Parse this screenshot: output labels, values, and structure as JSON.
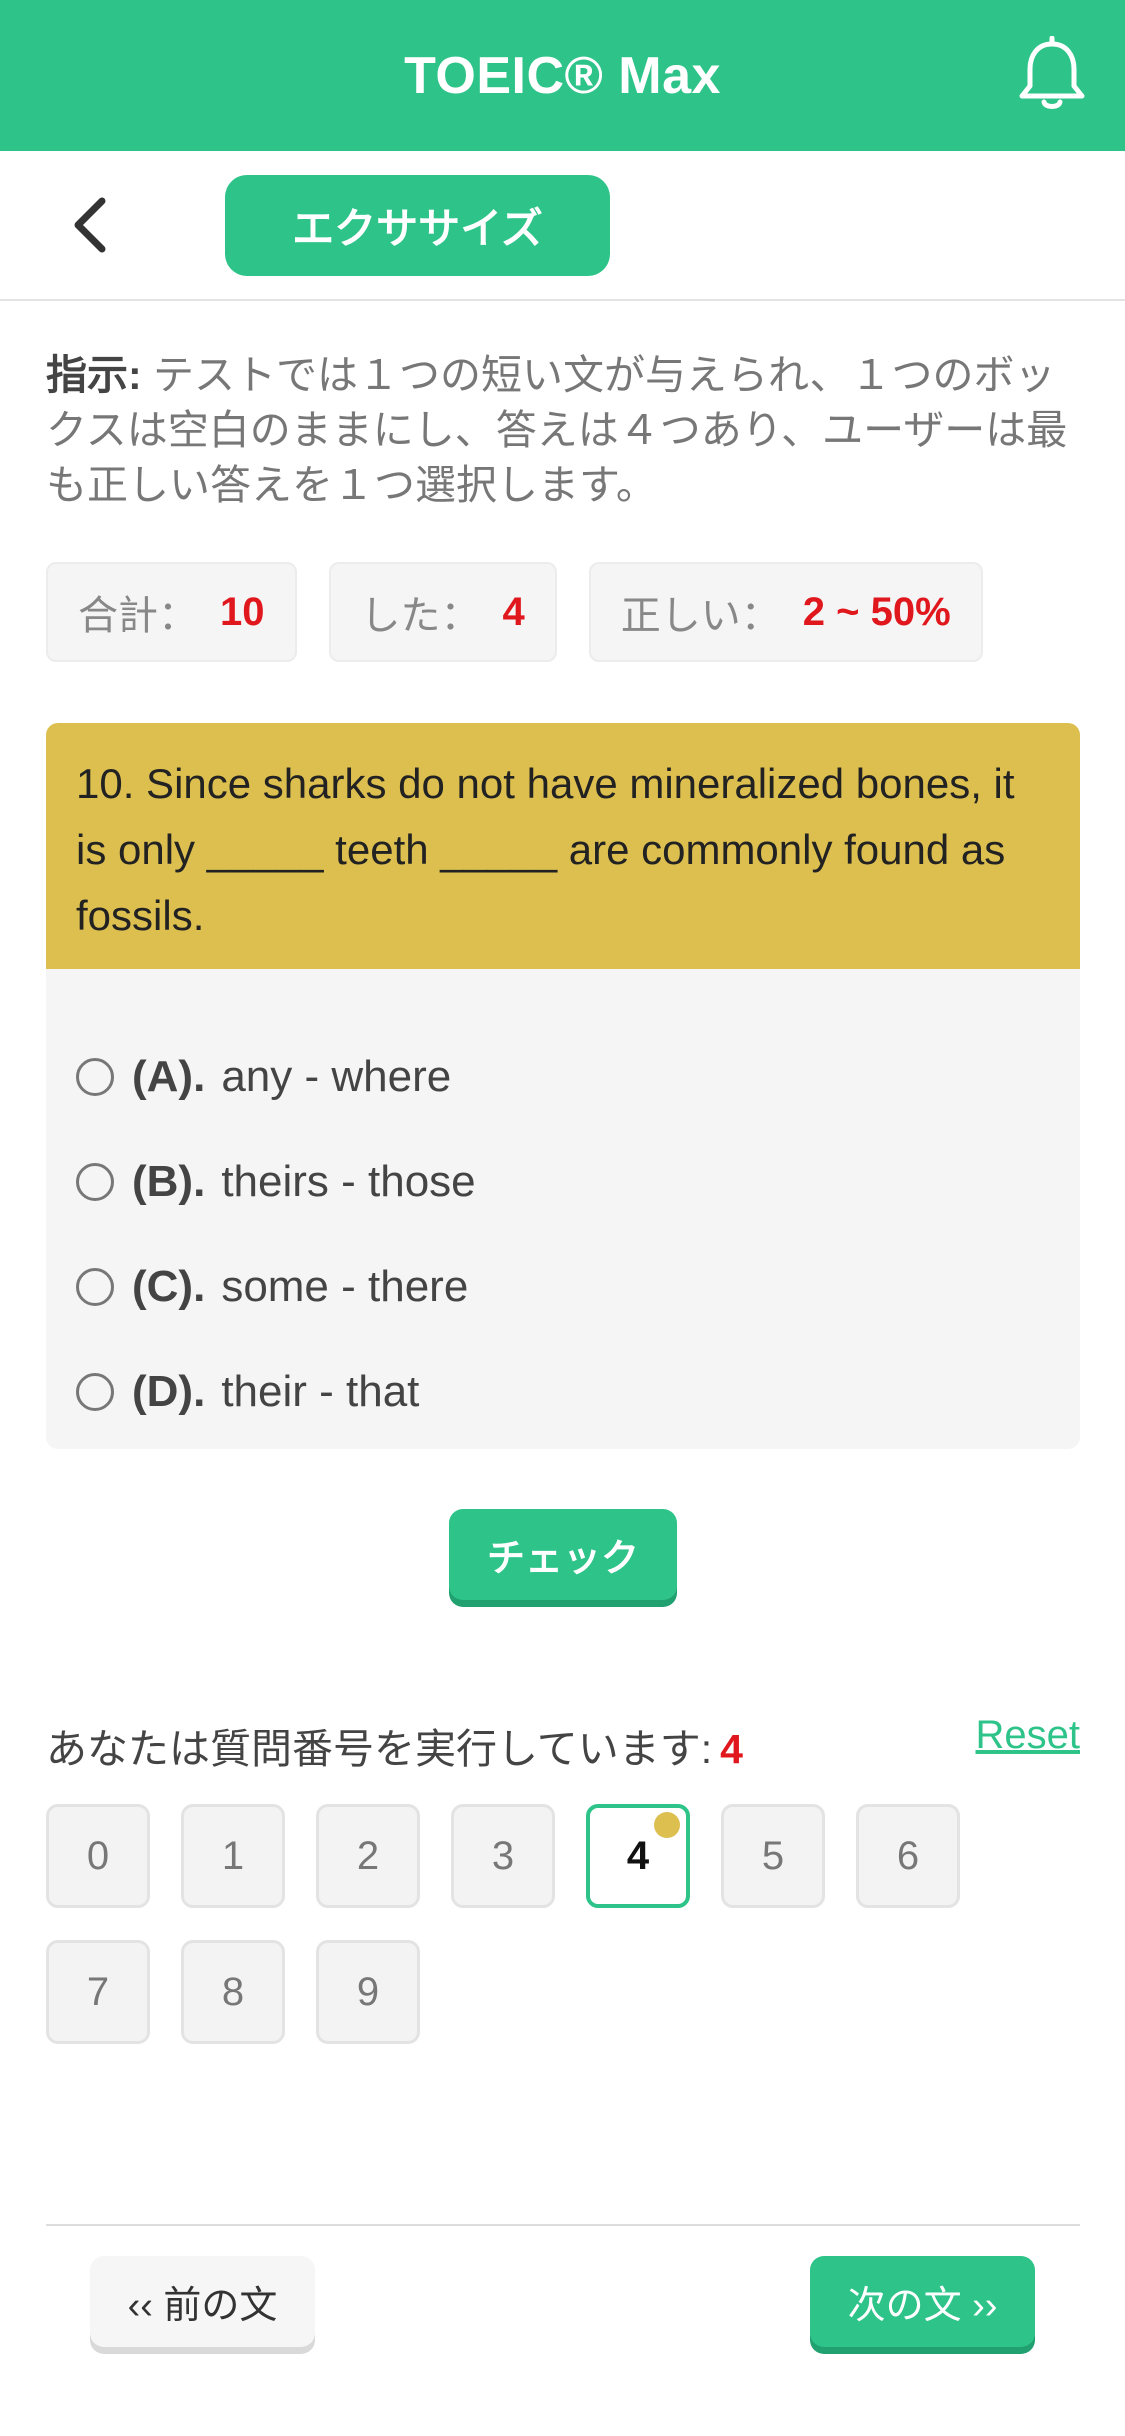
{
  "header": {
    "title": "TOEIC® Max"
  },
  "subnav": {
    "tab_label": "エクササイズ"
  },
  "instruction": {
    "label": "指示:",
    "text": " テストでは１つの短い文が与えられ、１つのボックスは空白のままにし、答えは４つあり、ユーザーは最も正しい答えを１つ選択します。"
  },
  "stats": {
    "total_label": "合計：",
    "total_value": "10",
    "done_label": "した：",
    "done_value": "4",
    "correct_label": "正しい：",
    "correct_value": "2 ~ 50%"
  },
  "question": {
    "text": "10. Since sharks do not have mineralized bones, it is only _____ teeth _____ are commonly found as fossils.",
    "options": [
      {
        "key": "(A).",
        "text": "any - where"
      },
      {
        "key": "(B).",
        "text": "theirs - those"
      },
      {
        "key": "(C).",
        "text": "some - there"
      },
      {
        "key": "(D).",
        "text": "their - that"
      }
    ]
  },
  "check_label": "チェック",
  "progress": {
    "label": "あなたは質問番号を実行しています:",
    "current": "4",
    "reset_label": "Reset",
    "numbers": [
      "0",
      "1",
      "2",
      "3",
      "4",
      "5",
      "6",
      "7",
      "8",
      "9"
    ],
    "active_index": 4
  },
  "footer": {
    "prev_label": "‹‹ 前の文",
    "next_label": "次の文 ››"
  },
  "colors": {
    "brand": "#2ec489",
    "question_bg": "#dcbf4f",
    "highlight": "#e0181e"
  }
}
